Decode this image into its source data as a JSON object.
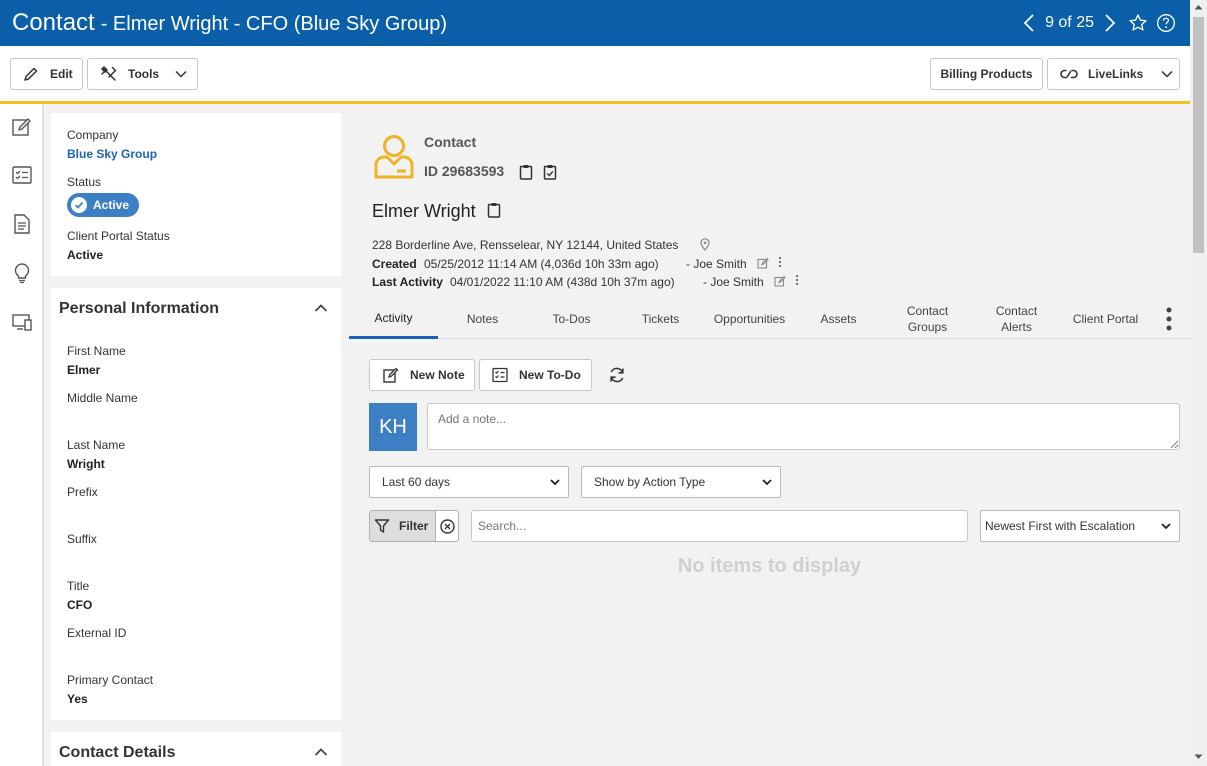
{
  "header": {
    "title": "Contact",
    "subtitle": "- Elmer Wright - CFO (Blue Sky Group)",
    "pager": "9 of 25"
  },
  "toolbar": {
    "edit_label": "Edit",
    "tools_label": "Tools",
    "billing_label": "Billing Products",
    "livelinks_label": "LiveLinks"
  },
  "summary": {
    "company_label": "Company",
    "company_value": "Blue Sky Group",
    "status_label": "Status",
    "status_value": "Active",
    "portal_status_label": "Client Portal Status",
    "portal_status_value": "Active"
  },
  "personal": {
    "title": "Personal Information",
    "fields": [
      {
        "label": "First Name",
        "value": "Elmer"
      },
      {
        "label": "Middle Name",
        "value": ""
      },
      {
        "label": "Last Name",
        "value": "Wright"
      },
      {
        "label": "Prefix",
        "value": ""
      },
      {
        "label": "Suffix",
        "value": ""
      },
      {
        "label": "Title",
        "value": "CFO"
      },
      {
        "label": "External ID",
        "value": ""
      },
      {
        "label": "Primary Contact",
        "value": "Yes"
      }
    ]
  },
  "contact_details": {
    "title": "Contact Details"
  },
  "record": {
    "type_label": "Contact",
    "id_text": "ID 29683593",
    "name": "Elmer Wright",
    "address": "228 Borderline Ave, Rensselear, NY 12144, United States",
    "created_label": "Created",
    "created_value": "05/25/2012 11:14 AM (4,036d 10h 33m ago)",
    "created_by": "- Joe Smith",
    "activity_label": "Last Activity",
    "activity_value": "04/01/2022 11:10 AM (438d 10h 37m ago)",
    "activity_by": "- Joe Smith"
  },
  "tabs": [
    {
      "label": "Activity"
    },
    {
      "label": "Notes"
    },
    {
      "label": "To-Dos"
    },
    {
      "label": "Tickets"
    },
    {
      "label": "Opportunities"
    },
    {
      "label": "Assets"
    },
    {
      "label": "Contact Groups"
    },
    {
      "label": "Contact Alerts"
    },
    {
      "label": "Client Portal"
    }
  ],
  "activity": {
    "new_note_label": "New Note",
    "new_todo_label": "New To-Do",
    "avatar_initials": "KH",
    "note_placeholder": "Add a note...",
    "range_select": "Last 60 days",
    "action_select": "Show by Action Type",
    "filter_label": "Filter",
    "search_placeholder": "Search...",
    "sort_select": "Newest First with Escalation",
    "empty_text": "No items to display"
  },
  "colors": {
    "header_bg": "#0a5fa8",
    "accent_yellow": "#f5c01e",
    "link_blue": "#1c63b8",
    "avatar_bg": "#3d7fc4"
  }
}
